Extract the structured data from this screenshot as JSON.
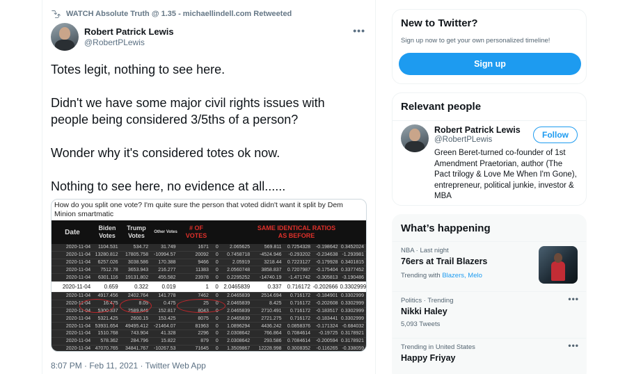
{
  "tweet": {
    "retweet_label": "WATCH Absolute Truth @ 1.35 - michaellindell.com Retweeted",
    "author_name": "Robert Patrick Lewis",
    "author_handle": "@RobertPLewis",
    "paragraphs": [
      "Totes legit, nothing to see here.",
      "Didn't we have some major civil rights issues with people being considered 3/5ths of a person?",
      "Wonder why it's considered totes ok now.",
      "Nothing to see here, no evidence at all......"
    ],
    "media_caption": "How do you split one vote? I'm quite sure the person that voted didn't want it split by Dem Minion smartmatic",
    "timestamp": "8:07 PM · Feb 11, 2021 · Twitter Web App"
  },
  "sheet": {
    "headers": [
      "Date",
      "Biden Votes",
      "Trump Votes",
      "Other Votes",
      "# OF VOTES",
      "",
      "SAME IDENTICAL RATIOS AS BEFORE"
    ],
    "rows": [
      [
        "2020-11-04",
        "1104.531",
        "534.72",
        "31.749",
        "1671",
        "0",
        "2.065625",
        "569.811",
        "0.7254328",
        "-0.198642",
        "0.3452024"
      ],
      [
        "2020-11-04",
        "13280.812",
        "17805.758",
        "-10994.57",
        "20092",
        "0",
        "0.7458718",
        "-4524.946",
        "-0.293202",
        "-0.234638",
        "-1.293981"
      ],
      [
        "2020-11-04",
        "6257.026",
        "3038.586",
        "170.388",
        "9466",
        "0",
        "2.05919",
        "3218.44",
        "0.7223127",
        "-0.179928",
        "0.3401815"
      ],
      [
        "2020-11-04",
        "7512.78",
        "3653.943",
        "216.277",
        "11383",
        "0",
        "2.0560748",
        "3858.837",
        "0.7207987",
        "-0.175404",
        "0.3377452"
      ],
      [
        "2020-11-04",
        "6301.116",
        "19131.802",
        "455.582",
        "23978",
        "0",
        "0.2295252",
        "-14740.19",
        "-1.471742",
        "-0.305813",
        "-3.190486"
      ],
      [
        "2020-11-04",
        "0.659",
        "0.322",
        "0.019",
        "1",
        "0",
        "2.0465839",
        "0.337",
        "0.716172",
        "-0.202666",
        "0.3302999"
      ],
      [
        "2020-11-04",
        "4917.456",
        "2402.764",
        "141.778",
        "7462",
        "0",
        "2.0465839",
        "2514.694",
        "0.716172",
        "-0.184901",
        "0.3302999"
      ],
      [
        "2020-11-04",
        "16.475",
        "8.05",
        "0.475",
        "25",
        "0",
        "2.0465839",
        "8.425",
        "0.716172",
        "-0.202608",
        "0.3302999"
      ],
      [
        "2020-11-04",
        "5300.337",
        "2589.846",
        "152.817",
        "8043",
        "0",
        "2.0465839",
        "2710.491",
        "0.716172",
        "-0.183517",
        "0.3302999"
      ],
      [
        "2020-11-04",
        "5321.425",
        "2600.15",
        "153.425",
        "8075",
        "0",
        "2.0465839",
        "2721.275",
        "0.716172",
        "-0.183441",
        "0.3302999"
      ],
      [
        "2020-11-04",
        "53931.654",
        "49495.412",
        "-21464.07",
        "81963",
        "0",
        "1.0896294",
        "4436.242",
        "0.0858376",
        "-0.171324",
        "-0.684032"
      ],
      [
        "2020-11-04",
        "1510.768",
        "743.904",
        "41.328",
        "2296",
        "0",
        "2.0308642",
        "766.864",
        "0.7084614",
        "-0.19725",
        "0.3178921"
      ],
      [
        "2020-11-04",
        "578.362",
        "284.796",
        "15.822",
        "879",
        "0",
        "2.0308642",
        "293.586",
        "0.7084614",
        "-0.200594",
        "0.3178921"
      ],
      [
        "2020-11-04",
        "47070.765",
        "34841.767",
        "-10267.53",
        "71645",
        "0",
        "1.3509867",
        "12228.998",
        "0.3008352",
        "-0.116265",
        "-0.338059"
      ]
    ]
  },
  "signup_panel": {
    "title": "New to Twitter?",
    "subtitle": "Sign up now to get your own personalized timeline!",
    "button": "Sign up"
  },
  "relevant_people": {
    "title": "Relevant people",
    "name": "Robert Patrick Lewis",
    "handle": "@RobertPLewis",
    "follow": "Follow",
    "bio": "Green Beret-turned co-founder of 1st Amendment Praetorian, author (The Pact trilogy & Love Me When I'm Gone), entrepreneur, political junkie, investor & MBA"
  },
  "trends": {
    "title": "What’s happening",
    "items": [
      {
        "meta": "NBA · Last night",
        "topic": "76ers at Trail Blazers",
        "extra_prefix": "Trending with ",
        "links": "Blazers, Melo"
      },
      {
        "meta": "Politics · Trending",
        "topic": "Nikki Haley",
        "extra": "5,093 Tweets"
      },
      {
        "meta": "Trending in United States",
        "topic": "Happy Friyay"
      }
    ]
  },
  "colors": {
    "accent": "#1d9bf0",
    "muted": "#536471",
    "highlight_ring": "#c0262a"
  }
}
